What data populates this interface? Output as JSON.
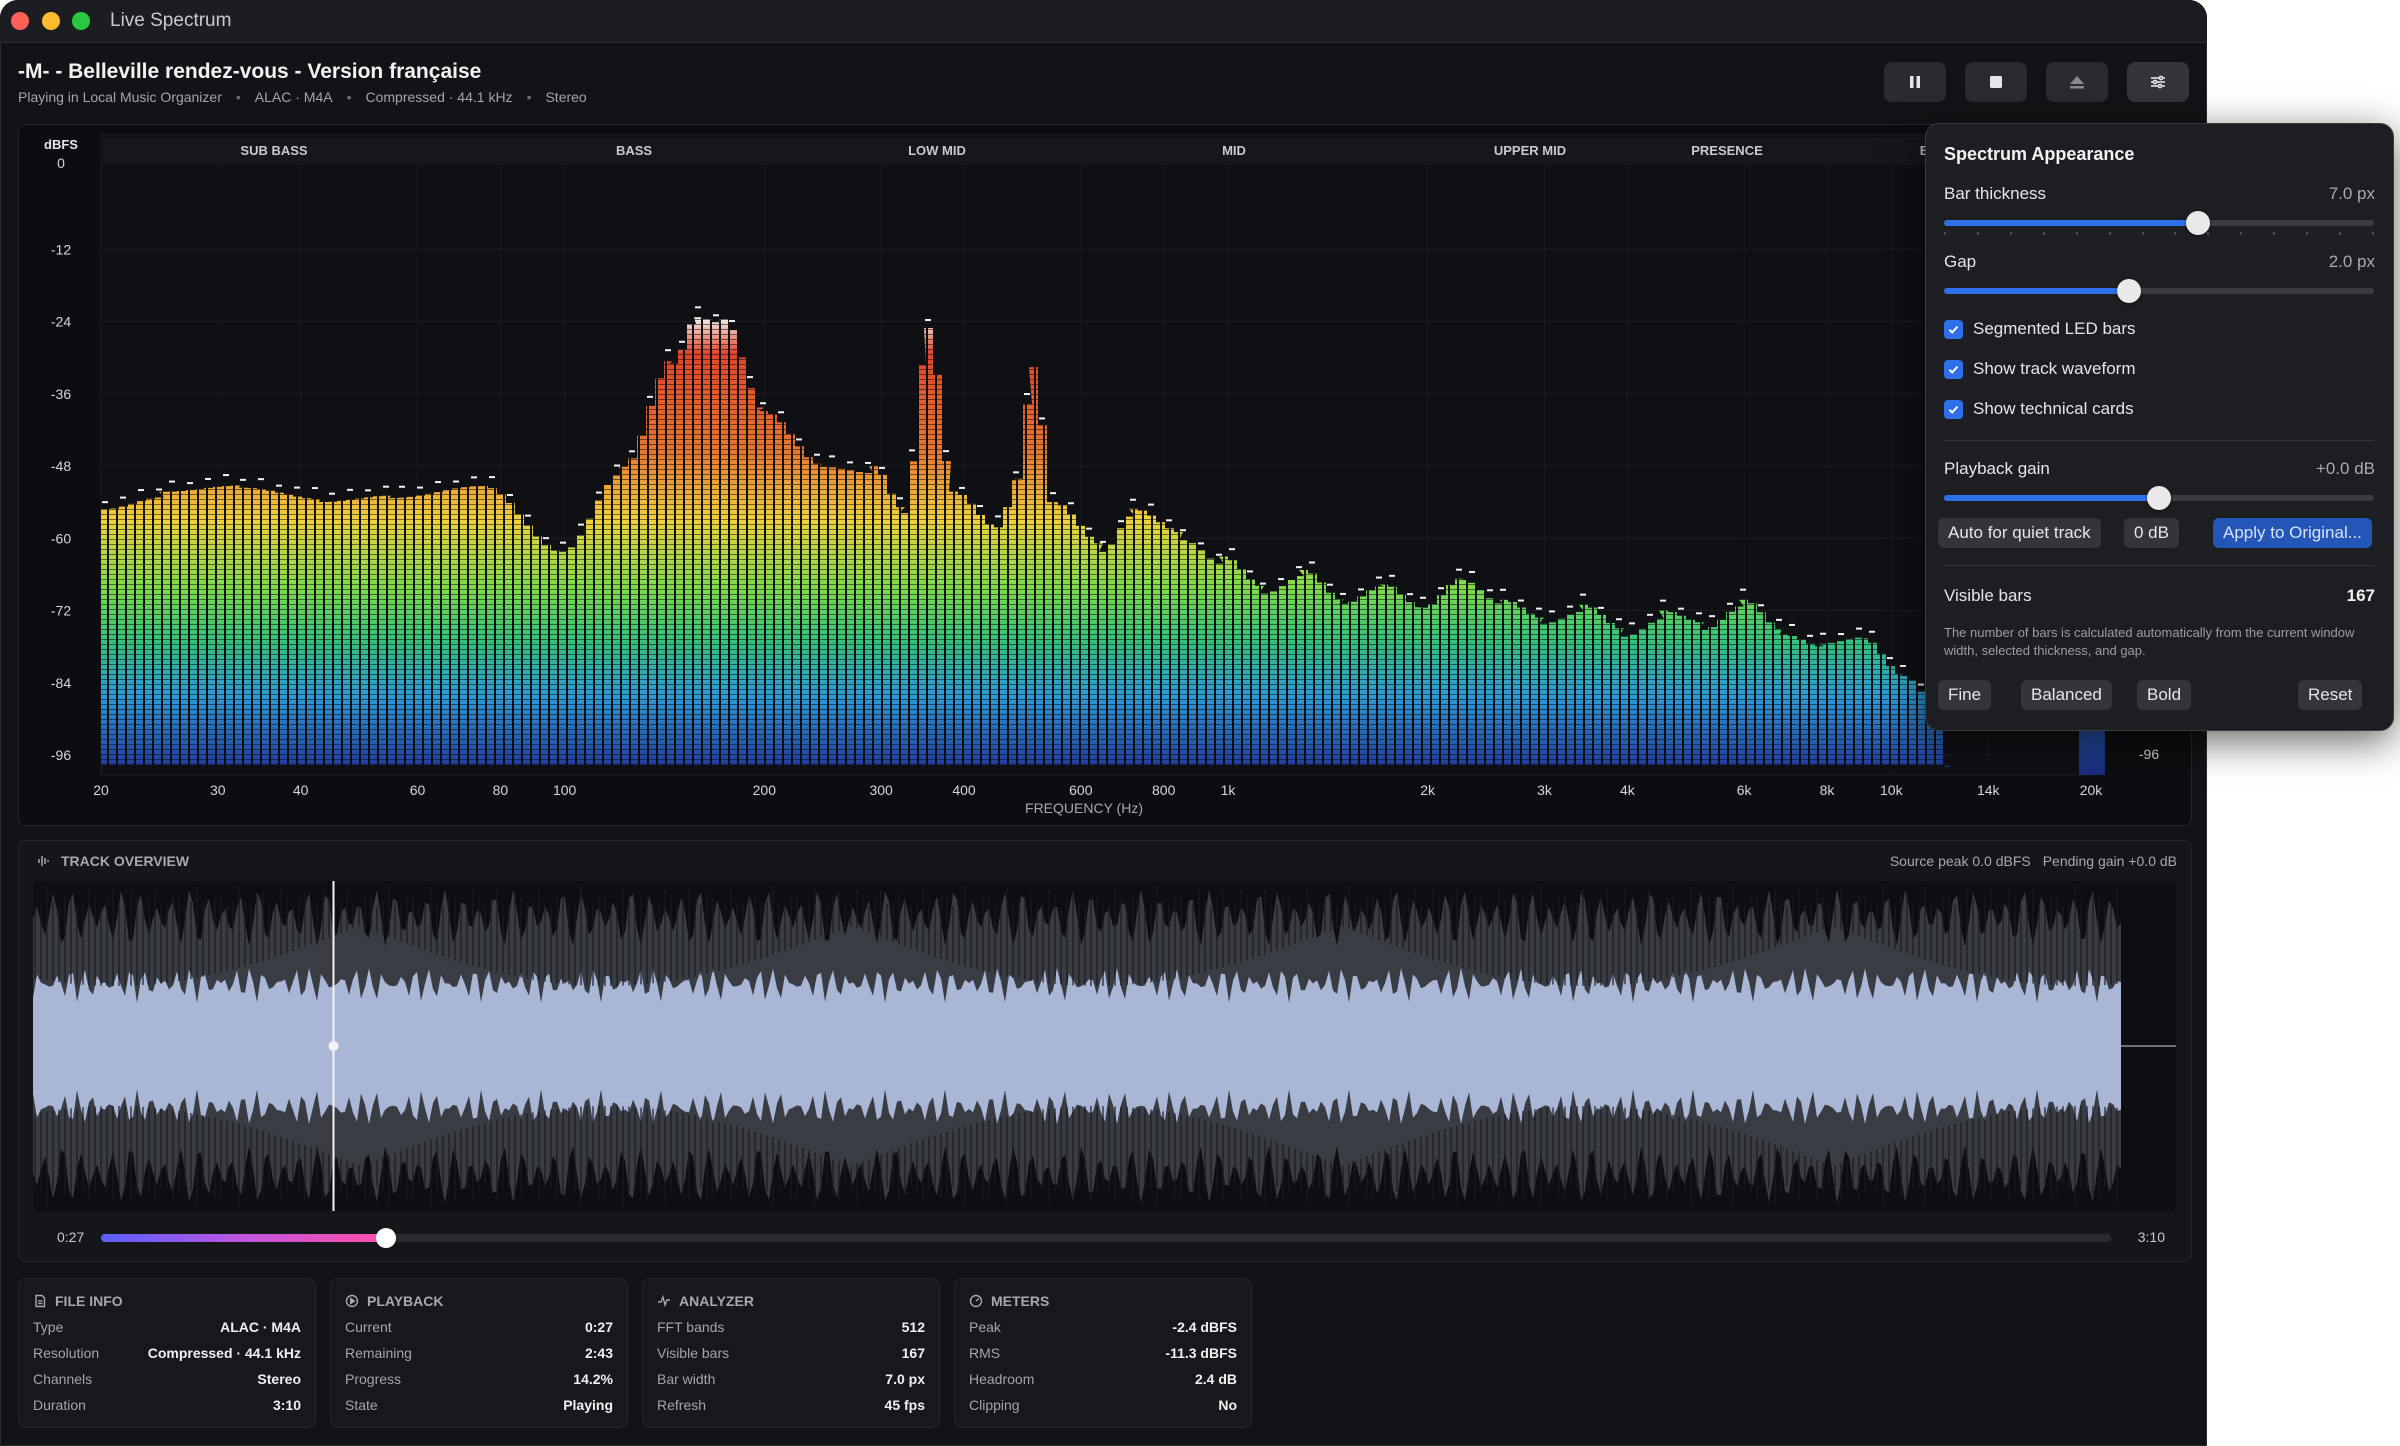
{
  "window": {
    "title": "Live Spectrum"
  },
  "track": {
    "title": "-M- - Belleville rendez-vous - Version française",
    "meta": [
      "Playing in Local Music Organizer",
      "ALAC · M4A",
      "Compressed · 44.1 kHz",
      "Stereo"
    ]
  },
  "toolbar": {
    "buttons": [
      "pause-icon",
      "stop-icon",
      "eject-icon",
      "sliders-icon"
    ]
  },
  "spectrum": {
    "db_unit": "dBFS",
    "db_ticks": [
      "0",
      "-12",
      "-24",
      "-36",
      "-48",
      "-60",
      "-72",
      "-84",
      "-96"
    ],
    "right_db_label": "-96",
    "bands": [
      "SUB BASS",
      "BASS",
      "LOW MID",
      "MID",
      "UPPER MID",
      "PRESENCE",
      "BRI"
    ],
    "freq_ticks": [
      "20",
      "30",
      "40",
      "60",
      "80",
      "100",
      "200",
      "300",
      "400",
      "600",
      "800",
      "1k",
      "2k",
      "3k",
      "4k",
      "6k",
      "8k",
      "10k",
      "14k",
      "20k"
    ],
    "freq_label": "FREQUENCY (Hz)"
  },
  "overview": {
    "title": "TRACK OVERVIEW",
    "source_peak": "Source peak 0.0 dBFS",
    "pending_gain": "Pending gain +0.0 dB",
    "current_time": "0:27",
    "total_time": "3:10",
    "progress": 0.142
  },
  "cards": {
    "file_info": {
      "title": "FILE INFO",
      "rows": [
        {
          "k": "Type",
          "v": "ALAC · M4A"
        },
        {
          "k": "Resolution",
          "v": "Compressed · 44.1 kHz"
        },
        {
          "k": "Channels",
          "v": "Stereo"
        },
        {
          "k": "Duration",
          "v": "3:10"
        }
      ]
    },
    "playback": {
      "title": "PLAYBACK",
      "rows": [
        {
          "k": "Current",
          "v": "0:27"
        },
        {
          "k": "Remaining",
          "v": "2:43"
        },
        {
          "k": "Progress",
          "v": "14.2%"
        },
        {
          "k": "State",
          "v": "Playing"
        }
      ]
    },
    "analyzer": {
      "title": "ANALYZER",
      "rows": [
        {
          "k": "FFT bands",
          "v": "512"
        },
        {
          "k": "Visible bars",
          "v": "167"
        },
        {
          "k": "Bar width",
          "v": "7.0 px"
        },
        {
          "k": "Refresh",
          "v": "45 fps"
        }
      ]
    },
    "meters": {
      "title": "METERS",
      "rows": [
        {
          "k": "Peak",
          "v": "-2.4 dBFS"
        },
        {
          "k": "RMS",
          "v": "-11.3 dBFS"
        },
        {
          "k": "Headroom",
          "v": "2.4 dB"
        },
        {
          "k": "Clipping",
          "v": "No"
        }
      ]
    }
  },
  "appearance": {
    "title": "Spectrum Appearance",
    "bar_thickness_label": "Bar thickness",
    "bar_thickness_value": "7.0 px",
    "bar_thickness_level": 0.59,
    "gap_label": "Gap",
    "gap_value": "2.0 px",
    "gap_level": 0.43,
    "checkboxes": [
      "Segmented LED bars",
      "Show track waveform",
      "Show technical cards"
    ],
    "gain_label": "Playback gain",
    "gain_value": "+0.0 dB",
    "gain_level": 0.5,
    "auto_button": "Auto for quiet track",
    "zero_button": "0 dB",
    "apply_button": "Apply to Original...",
    "visible_bars_label": "Visible bars",
    "visible_bars_value": "167",
    "note": "The number of bars is calculated automatically from the current window width, selected thickness, and gap.",
    "presets": [
      "Fine",
      "Balanced",
      "Bold"
    ],
    "reset": "Reset"
  }
}
